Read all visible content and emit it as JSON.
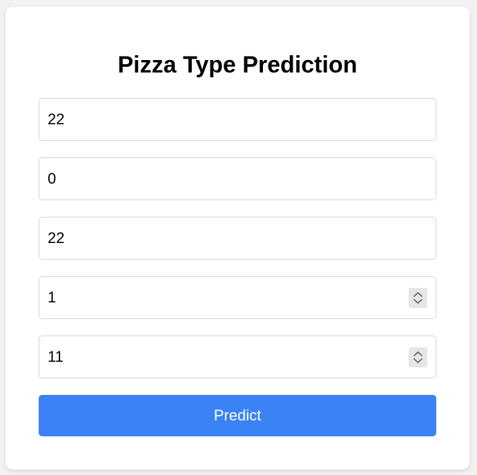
{
  "form": {
    "title": "Pizza Type Prediction",
    "fields": [
      {
        "value": "22"
      },
      {
        "value": "0"
      },
      {
        "value": "22"
      },
      {
        "value": "1"
      },
      {
        "value": "11"
      }
    ],
    "predict_label": "Predict"
  },
  "colors": {
    "primary": "#3b82f6",
    "background": "#f2f2f4",
    "card": "#ffffff",
    "border": "#d4d4d8"
  }
}
